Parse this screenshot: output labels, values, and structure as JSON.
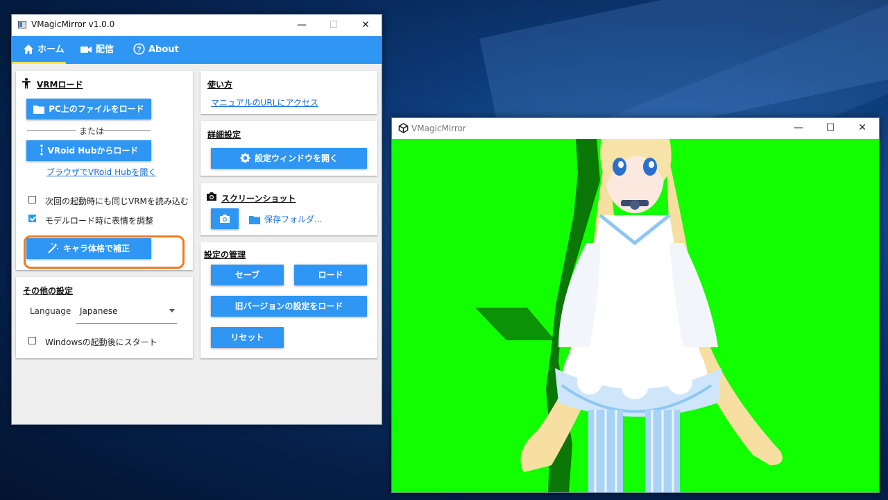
{
  "main_window": {
    "title": "VMagicMirror v1.0.0",
    "controls": {
      "minimize": "—",
      "maximize": "☐",
      "close": "✕"
    },
    "tabs": [
      {
        "label": "ホーム",
        "icon": "home-icon",
        "selected": true
      },
      {
        "label": "配信",
        "icon": "video-camera-icon",
        "selected": false
      },
      {
        "label": "About",
        "icon": "help-circle-icon",
        "selected": false
      }
    ]
  },
  "vrm_card": {
    "header": "VRMロード",
    "icon": "person-icon",
    "load_pc_button": "PC上のファイルをロード",
    "or_text": "または",
    "vroid_button": "VRoid Hubからロード",
    "vroid_link": "ブラウザでVRoid Hubを開く",
    "checkboxes": [
      {
        "label": "次回の起動時にも同じVRMを読み込む",
        "checked": false
      },
      {
        "label": "モデルロード時に表情を調整",
        "checked": true
      }
    ],
    "calibrate_button": "キャラ体格で補正"
  },
  "other_settings": {
    "header": "その他の設定",
    "language_label": "Language",
    "language_value": "Japanese",
    "startup_checkbox": {
      "label": "Windowsの起動後にスタート",
      "checked": false
    }
  },
  "usage_card": {
    "header": "使い方",
    "manual_link": "マニュアルのURLにアクセス"
  },
  "detail_card": {
    "header": "詳細設定",
    "open_settings_button": "設定ウィンドウを開く"
  },
  "screenshot_card": {
    "header": "スクリーンショット",
    "save_folder_label": "保存フォルダ..."
  },
  "settings_management": {
    "header": "設定の管理",
    "save_button": "セーブ",
    "load_button": "ロード",
    "legacy_load_button": "旧バージョンの設定をロード",
    "reset_button": "リセット"
  },
  "mirror_window": {
    "title": "VMagicMirror",
    "controls": {
      "minimize": "—",
      "maximize": "☐",
      "close": "✕"
    },
    "background_color": "#11ff00"
  },
  "colors": {
    "accent": "#2f96f3",
    "tab_indicator": "#ffe24a",
    "highlight_border": "#f07a1e",
    "link": "#1a6fd8"
  }
}
